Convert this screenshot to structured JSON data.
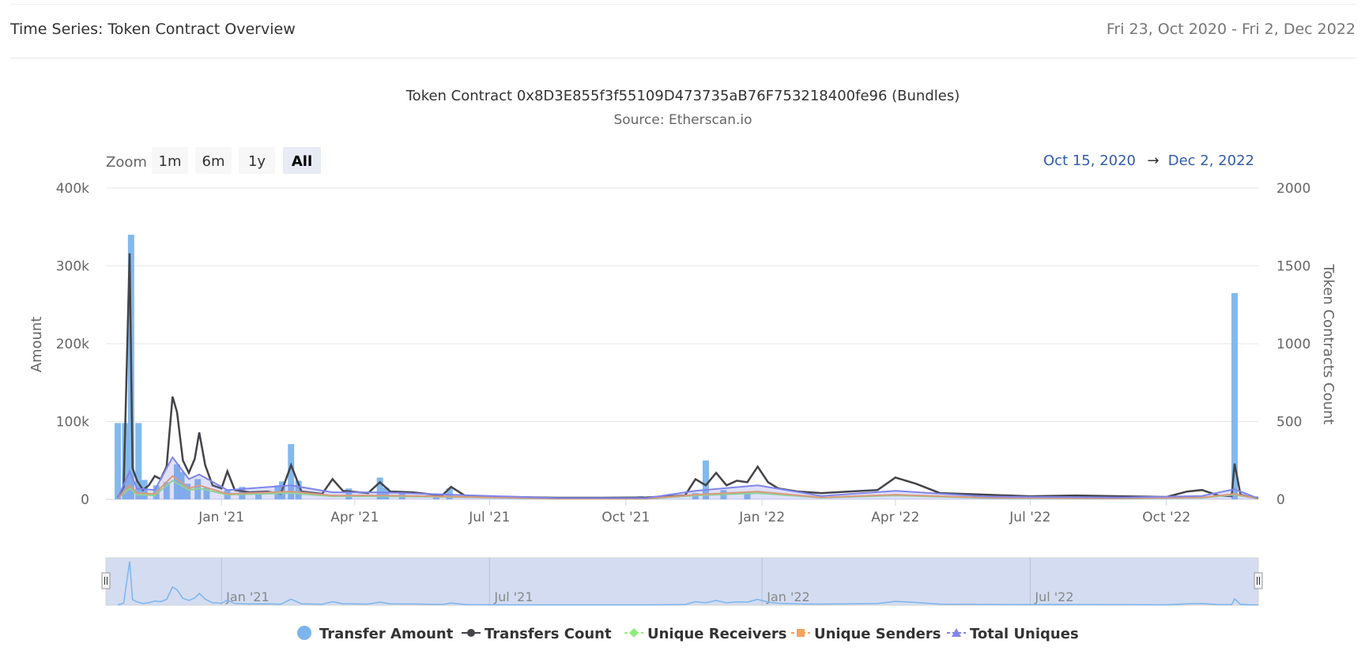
{
  "header": {
    "title": "Time Series: Token Contract Overview",
    "date_range": "Fri 23, Oct 2020 - Fri 2, Dec 2022"
  },
  "chart_data": {
    "type": "bar",
    "title": "Token Contract 0x8D3E855f3f55109D473735aB76F753218400fe96 (Bundles)",
    "subtitle": "Source: Etherscan.io",
    "zoom_label": "Zoom",
    "zoom_buttons": [
      "1m",
      "6m",
      "1y",
      "All"
    ],
    "zoom_selected": "All",
    "range_from": "Oct 15, 2020",
    "range_arrow": "→",
    "range_to": "Dec 2, 2022",
    "x_range": [
      "2020-10-15",
      "2022-12-02"
    ],
    "x_ticks": [
      "Jan '21",
      "Apr '21",
      "Jul '21",
      "Oct '21",
      "Jan '22",
      "Apr '22",
      "Jul '22",
      "Oct '22"
    ],
    "navigator_ticks": [
      "Jan '21",
      "Jul '21",
      "Jan '22",
      "Jul '22"
    ],
    "y_left": {
      "label": "Amount",
      "ticks": [
        "0",
        "100k",
        "200k",
        "300k",
        "400k"
      ],
      "range": [
        0,
        400000
      ]
    },
    "y_right": {
      "label": "Token Contracts Count",
      "ticks": [
        "0",
        "500",
        "1000",
        "1500",
        "2000"
      ],
      "range": [
        0,
        2000
      ]
    },
    "grid": true,
    "legend_position": "bottom",
    "colors": {
      "transfer_amount": "#7cb5ec",
      "transfers_count": "#434348",
      "unique_receivers": "#90ed7d",
      "unique_senders": "#f7a35c",
      "total_uniques": "#8085e9"
    },
    "series": [
      {
        "name": "Transfer Amount",
        "type": "column",
        "axis": "left",
        "points": [
          [
            "2020-10-23",
            98000
          ],
          [
            "2020-10-28",
            98000
          ],
          [
            "2020-11-01",
            340000
          ],
          [
            "2020-11-06",
            98000
          ],
          [
            "2020-11-10",
            25000
          ],
          [
            "2020-11-18",
            18000
          ],
          [
            "2020-11-25",
            22000
          ],
          [
            "2020-12-02",
            45000
          ],
          [
            "2020-12-05",
            35000
          ],
          [
            "2020-12-09",
            20000
          ],
          [
            "2020-12-16",
            26000
          ],
          [
            "2020-12-22",
            15000
          ],
          [
            "2021-01-05",
            12000
          ],
          [
            "2021-01-15",
            16000
          ],
          [
            "2021-01-26",
            8000
          ],
          [
            "2021-02-08",
            18000
          ],
          [
            "2021-02-11",
            23000
          ],
          [
            "2021-02-17",
            71000
          ],
          [
            "2021-02-22",
            24000
          ],
          [
            "2021-03-28",
            14000
          ],
          [
            "2021-04-18",
            28000
          ],
          [
            "2021-04-22",
            15000
          ],
          [
            "2021-05-03",
            9000
          ],
          [
            "2021-05-26",
            7000
          ],
          [
            "2021-06-04",
            14000
          ],
          [
            "2021-10-11",
            4000
          ],
          [
            "2021-11-17",
            8000
          ],
          [
            "2021-11-24",
            50000
          ],
          [
            "2021-12-06",
            12000
          ],
          [
            "2021-12-22",
            10000
          ],
          [
            "2022-11-16",
            265000
          ]
        ]
      },
      {
        "name": "Transfers Count",
        "type": "line",
        "axis": "right",
        "points": [
          [
            "2020-10-23",
            10
          ],
          [
            "2020-10-27",
            80
          ],
          [
            "2020-10-31",
            1580
          ],
          [
            "2020-11-02",
            200
          ],
          [
            "2020-11-05",
            120
          ],
          [
            "2020-11-09",
            60
          ],
          [
            "2020-11-13",
            90
          ],
          [
            "2020-11-17",
            150
          ],
          [
            "2020-11-21",
            130
          ],
          [
            "2020-11-25",
            210
          ],
          [
            "2020-11-29",
            660
          ],
          [
            "2020-12-02",
            560
          ],
          [
            "2020-12-06",
            250
          ],
          [
            "2020-12-10",
            170
          ],
          [
            "2020-12-14",
            260
          ],
          [
            "2020-12-17",
            430
          ],
          [
            "2020-12-21",
            220
          ],
          [
            "2020-12-26",
            90
          ],
          [
            "2021-01-01",
            70
          ],
          [
            "2021-01-05",
            180
          ],
          [
            "2021-01-10",
            60
          ],
          [
            "2021-01-20",
            45
          ],
          [
            "2021-02-01",
            50
          ],
          [
            "2021-02-10",
            35
          ],
          [
            "2021-02-17",
            220
          ],
          [
            "2021-02-24",
            50
          ],
          [
            "2021-03-10",
            35
          ],
          [
            "2021-03-17",
            130
          ],
          [
            "2021-03-24",
            55
          ],
          [
            "2021-04-10",
            40
          ],
          [
            "2021-04-18",
            110
          ],
          [
            "2021-04-25",
            50
          ],
          [
            "2021-05-10",
            45
          ],
          [
            "2021-05-30",
            25
          ],
          [
            "2021-06-05",
            80
          ],
          [
            "2021-06-15",
            20
          ],
          [
            "2021-07-15",
            15
          ],
          [
            "2021-08-15",
            10
          ],
          [
            "2021-09-15",
            10
          ],
          [
            "2021-10-15",
            12
          ],
          [
            "2021-11-10",
            25
          ],
          [
            "2021-11-17",
            130
          ],
          [
            "2021-11-24",
            90
          ],
          [
            "2021-12-01",
            170
          ],
          [
            "2021-12-08",
            90
          ],
          [
            "2021-12-15",
            120
          ],
          [
            "2021-12-22",
            110
          ],
          [
            "2021-12-29",
            210
          ],
          [
            "2022-01-05",
            110
          ],
          [
            "2022-01-12",
            70
          ],
          [
            "2022-01-25",
            50
          ],
          [
            "2022-02-10",
            40
          ],
          [
            "2022-03-01",
            50
          ],
          [
            "2022-03-20",
            60
          ],
          [
            "2022-04-01",
            140
          ],
          [
            "2022-04-15",
            100
          ],
          [
            "2022-05-01",
            40
          ],
          [
            "2022-06-01",
            30
          ],
          [
            "2022-07-01",
            20
          ],
          [
            "2022-08-01",
            25
          ],
          [
            "2022-09-01",
            20
          ],
          [
            "2022-10-01",
            15
          ],
          [
            "2022-10-15",
            50
          ],
          [
            "2022-10-25",
            60
          ],
          [
            "2022-11-05",
            25
          ],
          [
            "2022-11-14",
            20
          ],
          [
            "2022-11-16",
            230
          ],
          [
            "2022-11-20",
            30
          ],
          [
            "2022-11-26",
            15
          ],
          [
            "2022-12-02",
            10
          ]
        ]
      },
      {
        "name": "Unique Receivers",
        "type": "line",
        "axis": "right",
        "points": [
          [
            "2020-10-23",
            5
          ],
          [
            "2020-10-31",
            70
          ],
          [
            "2020-11-05",
            30
          ],
          [
            "2020-11-17",
            25
          ],
          [
            "2020-11-29",
            120
          ],
          [
            "2020-12-10",
            60
          ],
          [
            "2020-12-17",
            70
          ],
          [
            "2021-01-05",
            30
          ],
          [
            "2021-02-17",
            40
          ],
          [
            "2021-03-17",
            20
          ],
          [
            "2021-04-18",
            20
          ],
          [
            "2021-06-05",
            15
          ],
          [
            "2021-08-15",
            3
          ],
          [
            "2021-10-15",
            3
          ],
          [
            "2021-11-17",
            25
          ],
          [
            "2021-12-29",
            40
          ],
          [
            "2022-02-10",
            10
          ],
          [
            "2022-04-01",
            25
          ],
          [
            "2022-06-01",
            8
          ],
          [
            "2022-09-01",
            5
          ],
          [
            "2022-10-25",
            10
          ],
          [
            "2022-11-16",
            30
          ],
          [
            "2022-12-02",
            3
          ]
        ]
      },
      {
        "name": "Unique Senders",
        "type": "line",
        "axis": "right",
        "points": [
          [
            "2020-10-23",
            5
          ],
          [
            "2020-10-31",
            90
          ],
          [
            "2020-11-05",
            40
          ],
          [
            "2020-11-17",
            35
          ],
          [
            "2020-11-29",
            150
          ],
          [
            "2020-12-10",
            70
          ],
          [
            "2020-12-17",
            90
          ],
          [
            "2021-01-05",
            35
          ],
          [
            "2021-02-17",
            50
          ],
          [
            "2021-03-17",
            25
          ],
          [
            "2021-04-18",
            25
          ],
          [
            "2021-06-05",
            18
          ],
          [
            "2021-08-15",
            4
          ],
          [
            "2021-10-15",
            4
          ],
          [
            "2021-11-17",
            30
          ],
          [
            "2021-12-29",
            50
          ],
          [
            "2022-02-10",
            12
          ],
          [
            "2022-04-01",
            30
          ],
          [
            "2022-06-01",
            10
          ],
          [
            "2022-09-01",
            6
          ],
          [
            "2022-10-25",
            12
          ],
          [
            "2022-11-16",
            35
          ],
          [
            "2022-12-02",
            4
          ]
        ]
      },
      {
        "name": "Total Uniques",
        "type": "line",
        "axis": "right",
        "points": [
          [
            "2020-10-23",
            8
          ],
          [
            "2020-10-31",
            180
          ],
          [
            "2020-11-05",
            70
          ],
          [
            "2020-11-17",
            60
          ],
          [
            "2020-11-29",
            270
          ],
          [
            "2020-12-10",
            130
          ],
          [
            "2020-12-17",
            160
          ],
          [
            "2021-01-05",
            60
          ],
          [
            "2021-02-17",
            90
          ],
          [
            "2021-03-17",
            45
          ],
          [
            "2021-04-18",
            45
          ],
          [
            "2021-06-05",
            30
          ],
          [
            "2021-08-15",
            8
          ],
          [
            "2021-10-15",
            8
          ],
          [
            "2021-11-17",
            55
          ],
          [
            "2021-12-29",
            90
          ],
          [
            "2022-02-10",
            22
          ],
          [
            "2022-04-01",
            55
          ],
          [
            "2022-06-01",
            18
          ],
          [
            "2022-09-01",
            12
          ],
          [
            "2022-10-25",
            22
          ],
          [
            "2022-11-16",
            65
          ],
          [
            "2022-12-02",
            6
          ]
        ]
      }
    ]
  }
}
